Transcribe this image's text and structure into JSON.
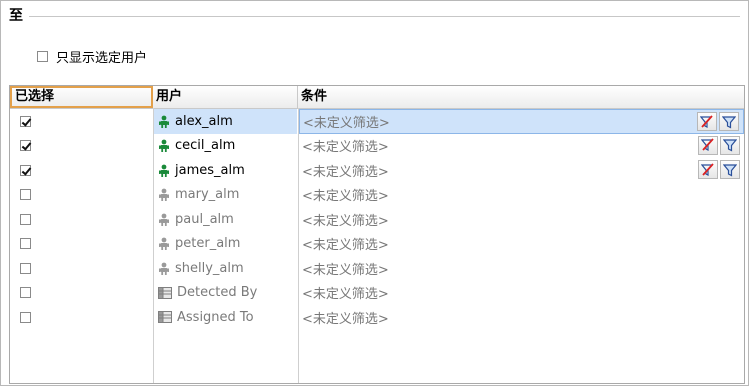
{
  "section": {
    "title": "至"
  },
  "only_selected": {
    "label": "只显示选定用户",
    "checked": false
  },
  "grid": {
    "headers": {
      "selected": "已选择",
      "user": "用户",
      "condition": "条件"
    },
    "rows": [
      {
        "checked": true,
        "name": "alex_alm",
        "kind": "user",
        "enabled": true,
        "condition": "<未定义筛选>",
        "active": true,
        "filters": true
      },
      {
        "checked": true,
        "name": "cecil_alm",
        "kind": "user",
        "enabled": true,
        "condition": "<未定义筛选>",
        "active": false,
        "filters": true
      },
      {
        "checked": true,
        "name": "james_alm",
        "kind": "user",
        "enabled": true,
        "condition": "<未定义筛选>",
        "active": false,
        "filters": true
      },
      {
        "checked": false,
        "name": "mary_alm",
        "kind": "user",
        "enabled": false,
        "condition": "<未定义筛选>",
        "active": false,
        "filters": false
      },
      {
        "checked": false,
        "name": "paul_alm",
        "kind": "user",
        "enabled": false,
        "condition": "<未定义筛选>",
        "active": false,
        "filters": false
      },
      {
        "checked": false,
        "name": "peter_alm",
        "kind": "user",
        "enabled": false,
        "condition": "<未定义筛选>",
        "active": false,
        "filters": false
      },
      {
        "checked": false,
        "name": "shelly_alm",
        "kind": "user",
        "enabled": false,
        "condition": "<未定义筛选>",
        "active": false,
        "filters": false
      },
      {
        "checked": false,
        "name": "Detected By",
        "kind": "field",
        "enabled": false,
        "condition": "<未定义筛选>",
        "active": false,
        "filters": false
      },
      {
        "checked": false,
        "name": "Assigned To",
        "kind": "field",
        "enabled": false,
        "condition": "<未定义筛选>",
        "active": false,
        "filters": false
      }
    ]
  },
  "colors": {
    "user_enabled": "#1a8a3a",
    "user_disabled": "#9a9a9a",
    "selection": "#cfe3fa",
    "header_focus": "#e3a04a"
  }
}
